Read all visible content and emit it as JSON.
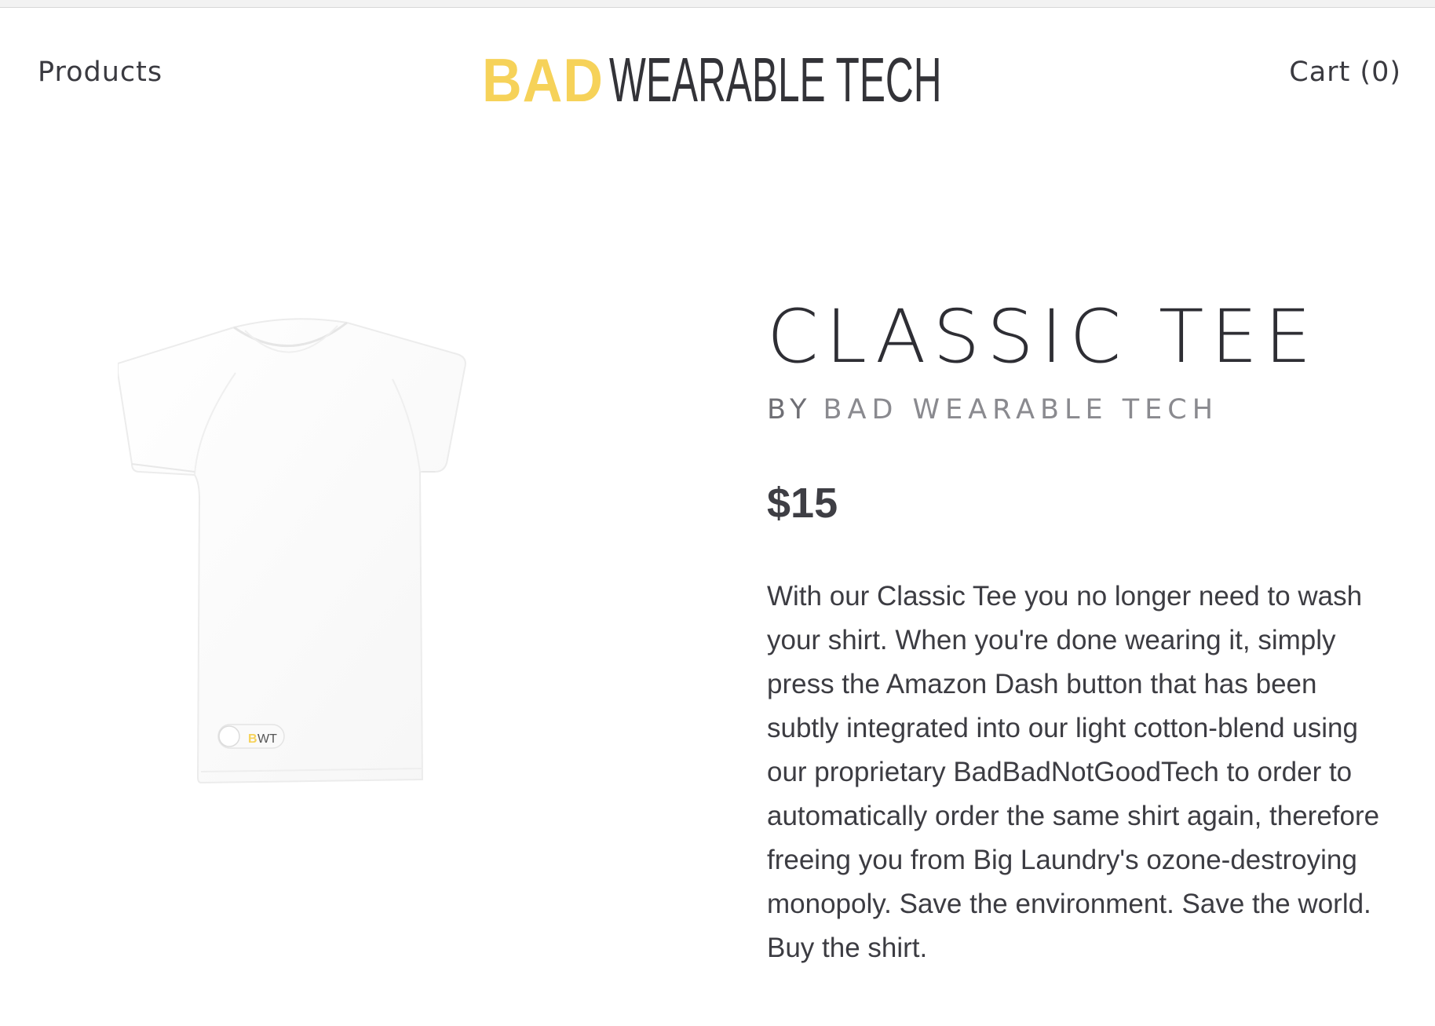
{
  "header": {
    "nav_left": "Products",
    "logo_bad": "BAD",
    "logo_rest": "WEARABLE TECH",
    "cart": "Cart (0)"
  },
  "product": {
    "title": "CLASSIC TEE",
    "by_label": "BY",
    "vendor": "BAD WEARABLE TECH",
    "price": "$15",
    "description": "With our Classic Tee you no longer need to wash your shirt. When you're done wearing it, simply press the Amazon Dash button that has been subtly integrated into our light cotton-blend using our proprietary BadBadNotGoodTech to order to automatically order the same shirt again, therefore freeing you from Big Laundry's ozone-destroying monopoly. Save the environment. Save the world. Buy the shirt.",
    "image": {
      "tag_b": "B",
      "tag_wt": "WT"
    }
  },
  "colors": {
    "brand_yellow": "#f6d259",
    "text_dark": "#333338",
    "text_muted": "#8a8a8f"
  }
}
